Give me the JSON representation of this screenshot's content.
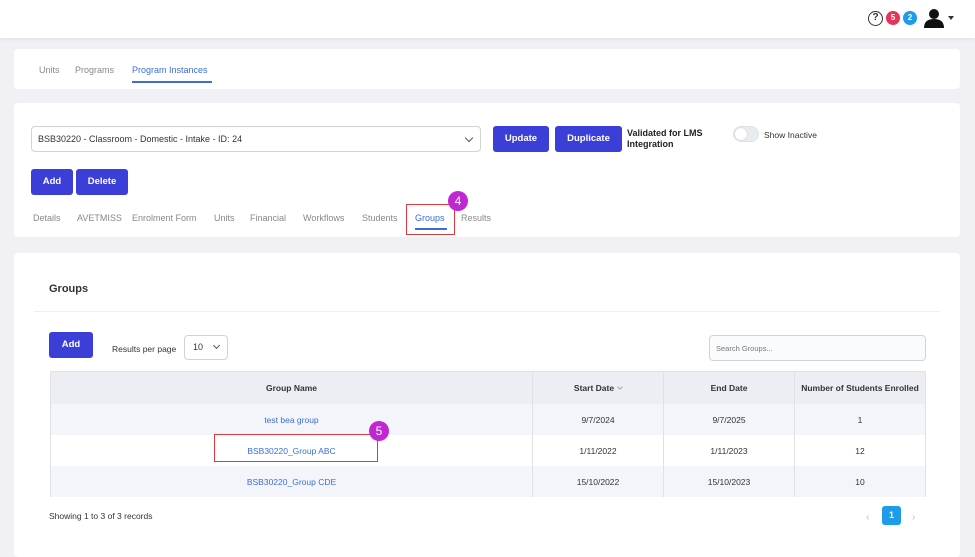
{
  "header": {
    "help_icon": "question-circle-icon",
    "help_glyph": "?",
    "notification_badge_red": "5",
    "notification_badge_blue": "2",
    "avatar_icon": "user-icon"
  },
  "top_nav": {
    "items": [
      "Units",
      "Programs",
      "Program Instances"
    ],
    "active": "Program Instances"
  },
  "instance": {
    "selected": "BSB30220 - Classroom - Domestic - Intake - ID: 24",
    "update_label": "Update",
    "duplicate_label": "Duplicate",
    "lms_label": "Validated for LMS Integration",
    "show_inactive_label": "Show Inactive",
    "add_label": "Add",
    "delete_label": "Delete"
  },
  "tabs": {
    "items": [
      "Details",
      "AVETMISS",
      "Enrolment Form",
      "Units",
      "Financial",
      "Workflows",
      "Students",
      "Groups",
      "Results"
    ],
    "active": "Groups"
  },
  "annotations": {
    "step4": "4",
    "step5": "5",
    "highlight_color": "#e03a3a",
    "badge_color": "#c026d3"
  },
  "groups": {
    "title": "Groups",
    "add_label": "Add",
    "rpp_label": "Results per page",
    "rpp_value": "10",
    "search_placeholder": "Search Groups...",
    "columns": [
      "Group Name",
      "Start Date",
      "End Date",
      "Number of Students Enrolled"
    ],
    "rows": [
      {
        "name": "test bea group",
        "start": "9/7/2024",
        "end": "9/7/2025",
        "count": "1"
      },
      {
        "name": "BSB30220_Group ABC",
        "start": "1/11/2022",
        "end": "1/11/2023",
        "count": "12"
      },
      {
        "name": "BSB30220_Group CDE",
        "start": "15/10/2022",
        "end": "15/10/2023",
        "count": "10"
      }
    ],
    "showing": "Showing 1 to 3 of 3 records",
    "page_prev": "‹",
    "page_current": "1",
    "page_next": "›"
  },
  "colors": {
    "primary_button": "#3b3fd8",
    "link": "#3b6ed8",
    "page_active": "#1e9be9"
  }
}
